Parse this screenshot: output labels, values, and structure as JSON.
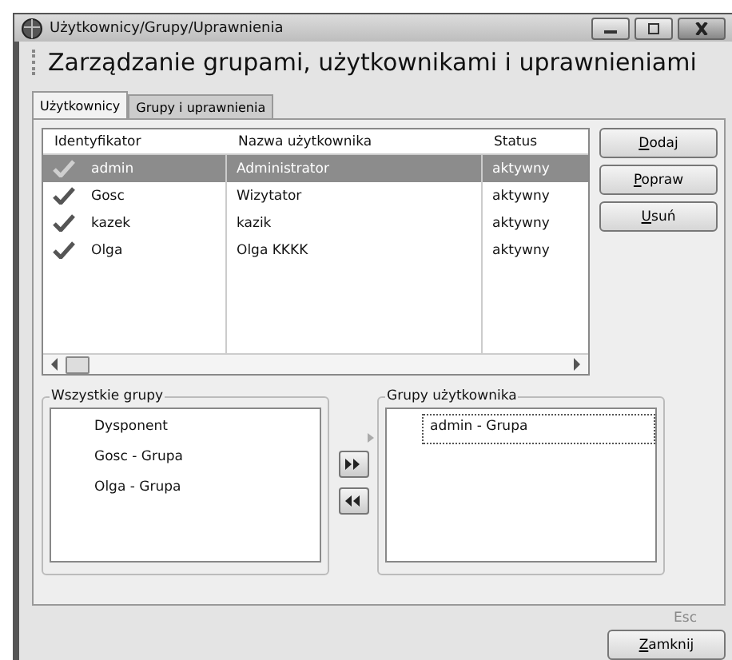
{
  "window": {
    "title": "Użytkownicy/Grupy/Uprawnienia"
  },
  "header": "Zarządzanie grupami, użytkownikami i uprawnieniami",
  "tabs": [
    {
      "label": "Użytkownicy",
      "selected": true
    },
    {
      "label": "Grupy i uprawnienia",
      "selected": false
    }
  ],
  "table": {
    "columns": [
      "Identyfikator",
      "Nazwa użytkownika",
      "Status"
    ],
    "rows": [
      {
        "id": "admin",
        "name": "Administrator",
        "status": "aktywny",
        "selected": true
      },
      {
        "id": "Gosc",
        "name": "Wizytator",
        "status": "aktywny",
        "selected": false
      },
      {
        "id": "kazek",
        "name": "kazik",
        "status": "aktywny",
        "selected": false
      },
      {
        "id": "Olga",
        "name": "Olga KKKK",
        "status": "aktywny",
        "selected": false
      }
    ]
  },
  "side_buttons": [
    "Dodaj",
    "Popraw",
    "Usuń"
  ],
  "all_groups": {
    "title": "Wszystkie grupy",
    "items": [
      {
        "label": "Dysponent",
        "selected": false
      },
      {
        "label": "Gosc - Grupa",
        "selected": false
      },
      {
        "label": "Olga - Grupa",
        "selected": false
      }
    ]
  },
  "user_groups": {
    "title": "Grupy użytkownika",
    "items": [
      {
        "label": "admin - Grupa",
        "selected": true
      }
    ]
  },
  "footer": {
    "hint": "Esc",
    "button": "Zamknij"
  }
}
